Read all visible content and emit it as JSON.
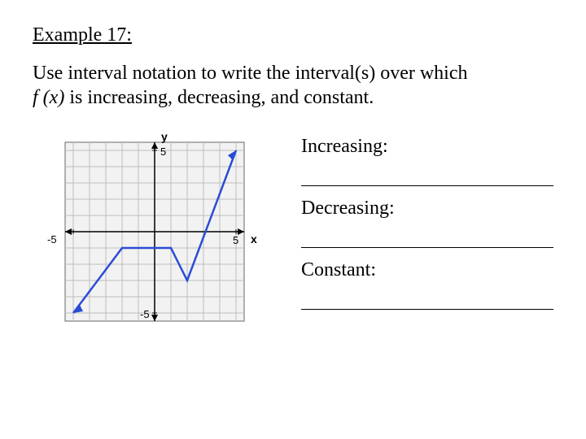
{
  "title": "Example 17:",
  "prompt_line1": "Use interval notation to write the interval(s) over which",
  "fx_label": "f (x)",
  "prompt_line2_rest": " is increasing, decreasing, and constant.",
  "answers": {
    "increasing_label": "Increasing:",
    "decreasing_label": "Decreasing:",
    "constant_label": "Constant:"
  },
  "graph": {
    "x_axis_label": "x",
    "y_axis_label": "y",
    "x_tick_neg": "-5",
    "x_tick_pos": "5",
    "y_tick_neg": "-5",
    "y_tick_pos": "5"
  },
  "chart_data": {
    "type": "line",
    "title": "",
    "xlabel": "x",
    "ylabel": "y",
    "xlim": [
      -6,
      6
    ],
    "ylim": [
      -6,
      6
    ],
    "series": [
      {
        "name": "f(x)",
        "points": [
          {
            "x": -5,
            "y": -5
          },
          {
            "x": -2,
            "y": -1
          },
          {
            "x": 1,
            "y": -1
          },
          {
            "x": 2,
            "y": -3
          },
          {
            "x": 5,
            "y": 5
          }
        ]
      }
    ]
  }
}
